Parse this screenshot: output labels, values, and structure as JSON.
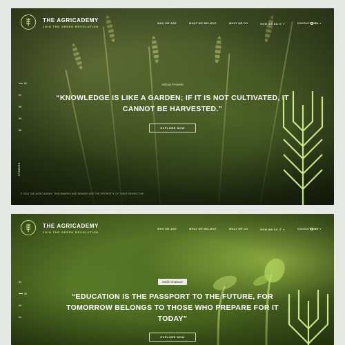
{
  "colors": {
    "accent": "#c9e58a",
    "text": "#ffffff"
  },
  "panels": [
    {
      "brand": {
        "name": "THE AGRICADEMY",
        "tagline": "JOIN THE GREEN REVOLUTION",
        "logo_icon": "wheat-icon"
      },
      "nav": [
        {
          "label": "WHO WE ARE"
        },
        {
          "label": "WHAT WE BELIEVE"
        },
        {
          "label": "WHAT WE DO"
        },
        {
          "label": "HOW WE DO IT",
          "caret": "▾"
        },
        {
          "label": "CONTACT US"
        }
      ],
      "lang": "EN",
      "pager": [
        "01",
        "02",
        "03",
        "04",
        "05"
      ],
      "side_label": "STORIES",
      "author": "African Proverb",
      "quote": "“KNOWLEDGE IS LIKE A GARDEN; IF IT IS NOT CULTIVATED, IT CANNOT BE HARVESTED.”",
      "cta": "EXPLORE NOW",
      "copyright": "© 2018 THE AGRICADEMY. TRADEMARKS AND BRANDS ARE THE PROPERTY OF THEIR RESPECTIVE"
    },
    {
      "brand": {
        "name": "THE AGRICADEMY",
        "tagline": "JOIN THE GREEN REVOLUTION",
        "logo_icon": "wheat-icon"
      },
      "nav": [
        {
          "label": "WHO WE ARE"
        },
        {
          "label": "WHAT WE BELIEVE"
        },
        {
          "label": "WHAT WE DO"
        },
        {
          "label": "HOW WE DO IT",
          "caret": "▾"
        },
        {
          "label": "CONTACT US"
        }
      ],
      "lang": "EN",
      "pager": [
        "01",
        "02",
        "03",
        "04"
      ],
      "author": "Malik Shabazz",
      "quote": "“EDUCATION IS THE PASSPORT TO THE FUTURE, FOR TOMORROW BELONGS TO THOSE WHO PREPARE FOR IT TODAY”",
      "cta": "EXPLORE NOW"
    }
  ]
}
